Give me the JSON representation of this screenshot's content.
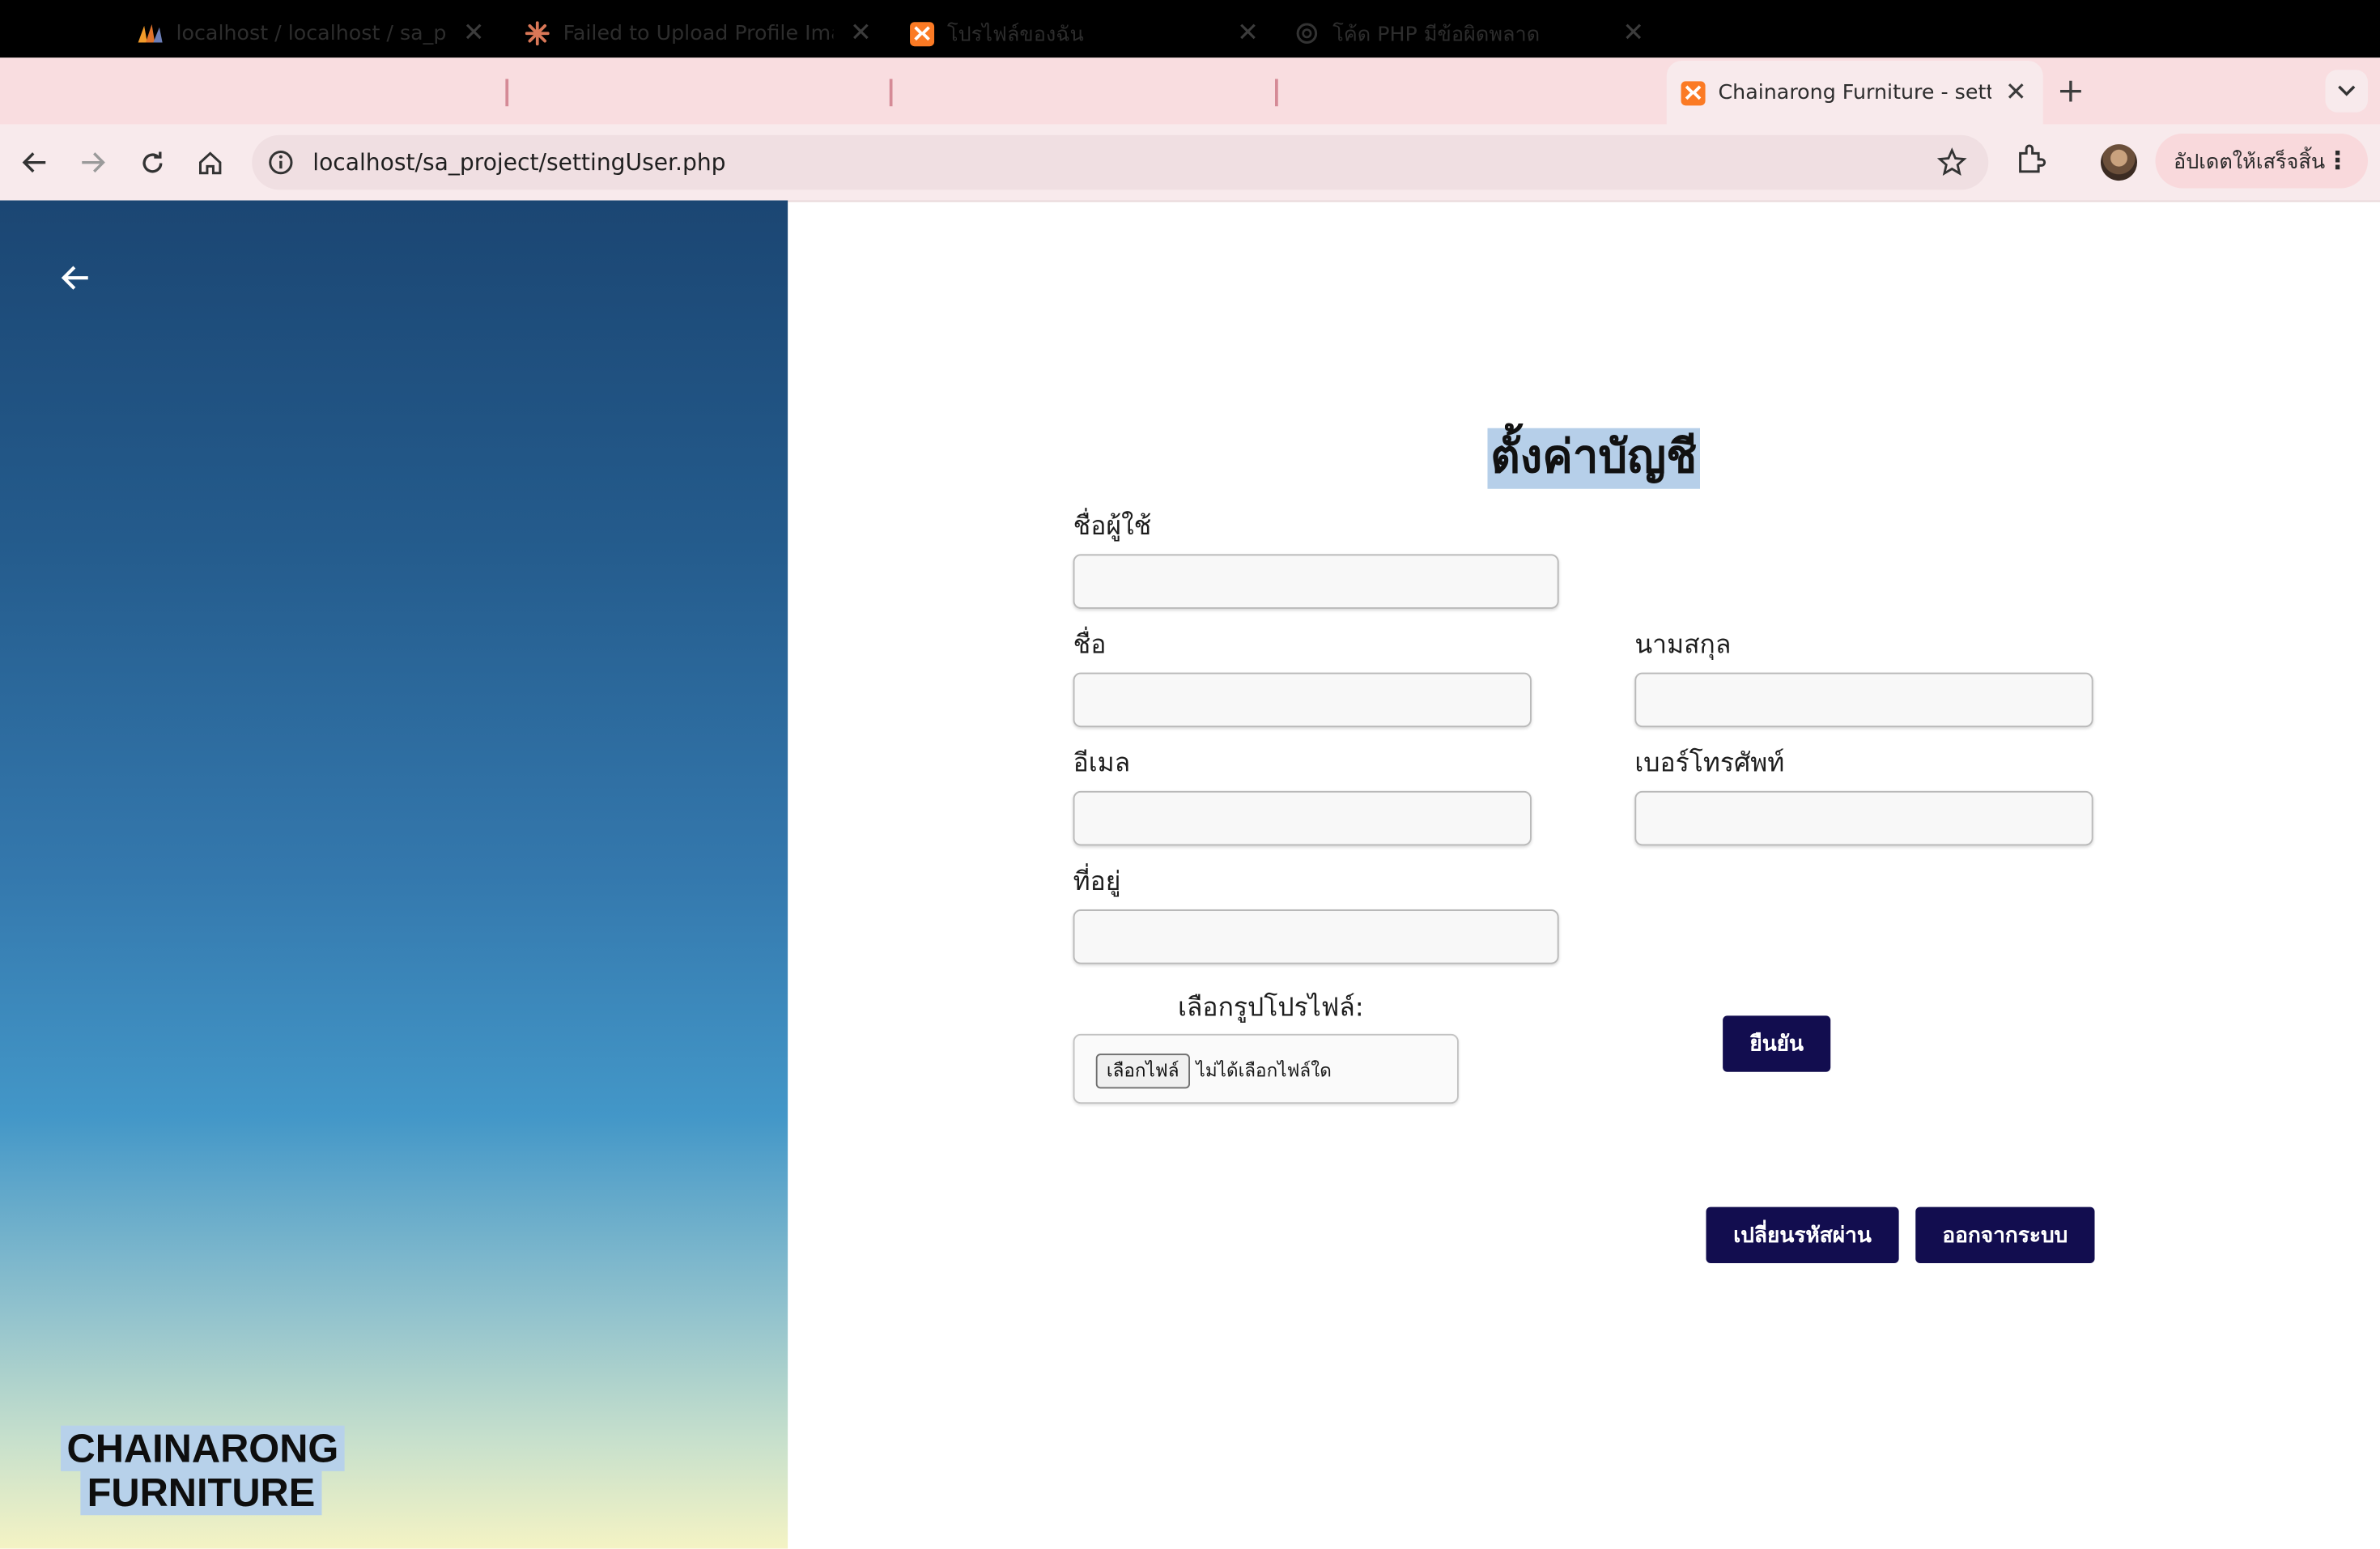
{
  "browser": {
    "tabs": [
      {
        "title": "localhost / localhost / sa_proj",
        "icon": "phpmyadmin-icon"
      },
      {
        "title": "Failed to Upload Profile Image",
        "icon": "claude-icon"
      },
      {
        "title": "โปรไฟล์ของฉัน",
        "icon": "xampp-icon"
      },
      {
        "title": "โค้ด PHP มีข้อผิดพลาด",
        "icon": "chatgpt-icon"
      },
      {
        "title": "Chainarong Furniture - setting",
        "icon": "xampp-icon",
        "active": true
      }
    ],
    "url": "localhost/sa_project/settingUser.php",
    "update_button": "อัปเดตให้เสร็จสิ้น"
  },
  "sidebar": {
    "brand_line1": "CHAINARONG",
    "brand_line2": "FURNITURE"
  },
  "form": {
    "title": "ตั้งค่าบัญชี",
    "username_label": "ชื่อผู้ใช้",
    "firstname_label": "ชื่อ",
    "lastname_label": "นามสกุล",
    "email_label": "อีเมล",
    "phone_label": "เบอร์โทรศัพท์",
    "address_label": "ที่อยู่",
    "profile_image_label": "เลือกรูปโปรไฟล์:",
    "file_button": "เลือกไฟล์",
    "file_status": "ไม่ได้เลือกไฟล์ใด",
    "confirm_button": "ยืนยัน",
    "change_password_button": "เปลี่ยนรหัสผ่าน",
    "logout_button": "ออกจากระบบ"
  },
  "colors": {
    "tabbar_bg": "#f9dde0",
    "button_dark": "#120d4f",
    "selection_highlight": "#b6cfe9"
  }
}
